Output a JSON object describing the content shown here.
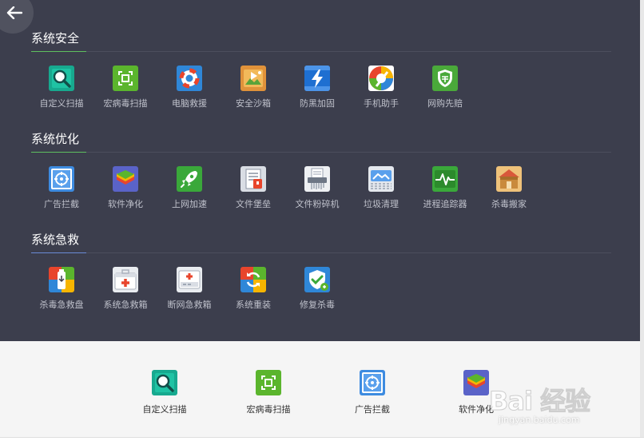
{
  "sections": [
    {
      "title": "系统安全",
      "accent": "#5fbf5f",
      "tools": [
        {
          "label": "自定义扫描",
          "icon": "magnifier-icon"
        },
        {
          "label": "宏病毒扫描",
          "icon": "virus-scan-icon"
        },
        {
          "label": "电脑救援",
          "icon": "lifebuoy-icon"
        },
        {
          "label": "安全沙箱",
          "icon": "sandbox-icon"
        },
        {
          "label": "防黑加固",
          "icon": "lightning-shield-icon"
        },
        {
          "label": "手机助手",
          "icon": "phone-assistant-icon"
        },
        {
          "label": "网购先赔",
          "icon": "shopping-shield-icon"
        }
      ]
    },
    {
      "title": "系统优化",
      "accent": "#5fbf5f",
      "tools": [
        {
          "label": "广告拦截",
          "icon": "ad-block-icon"
        },
        {
          "label": "软件净化",
          "icon": "layers-icon"
        },
        {
          "label": "上网加速",
          "icon": "rocket-icon"
        },
        {
          "label": "文件堡垒",
          "icon": "file-vault-icon"
        },
        {
          "label": "文件粉碎机",
          "icon": "shredder-icon"
        },
        {
          "label": "垃圾清理",
          "icon": "cleanup-icon"
        },
        {
          "label": "进程追踪器",
          "icon": "process-tracker-icon"
        },
        {
          "label": "杀毒搬家",
          "icon": "house-box-icon"
        }
      ]
    },
    {
      "title": "系统急救",
      "accent": "#6a8bd6",
      "tools": [
        {
          "label": "杀毒急救盘",
          "icon": "usb-rescue-icon"
        },
        {
          "label": "系统急救箱",
          "icon": "first-aid-box-icon"
        },
        {
          "label": "断网急救箱",
          "icon": "network-aid-icon"
        },
        {
          "label": "系统重装",
          "icon": "reinstall-icon"
        },
        {
          "label": "修复杀毒",
          "icon": "repair-shield-icon"
        }
      ]
    }
  ],
  "bottom_tools": [
    {
      "label": "自定义扫描",
      "icon": "magnifier-icon"
    },
    {
      "label": "宏病毒扫描",
      "icon": "virus-scan-icon"
    },
    {
      "label": "广告拦截",
      "icon": "ad-block-icon"
    },
    {
      "label": "软件净化",
      "icon": "layers-icon"
    }
  ],
  "watermark": {
    "text": "Bai 经验",
    "url": "jingyan.baidu.com"
  },
  "colors": {
    "panel_bg": "#3c3e4d",
    "bottom_bg": "#f5f5f5"
  }
}
